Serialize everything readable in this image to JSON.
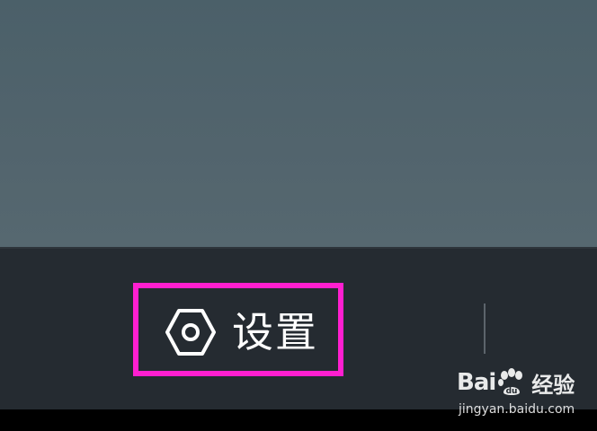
{
  "menu": {
    "settings_label": "设置",
    "settings_icon": "hexagon-settings-icon"
  },
  "colors": {
    "highlight_border": "#ff1fd0",
    "bar_background": "#252b31",
    "top_background": "#52646d"
  },
  "watermark": {
    "logo_prefix": "Bai",
    "logo_du": "du",
    "logo_suffix": "经验",
    "url": "jingyan.baidu.com"
  }
}
